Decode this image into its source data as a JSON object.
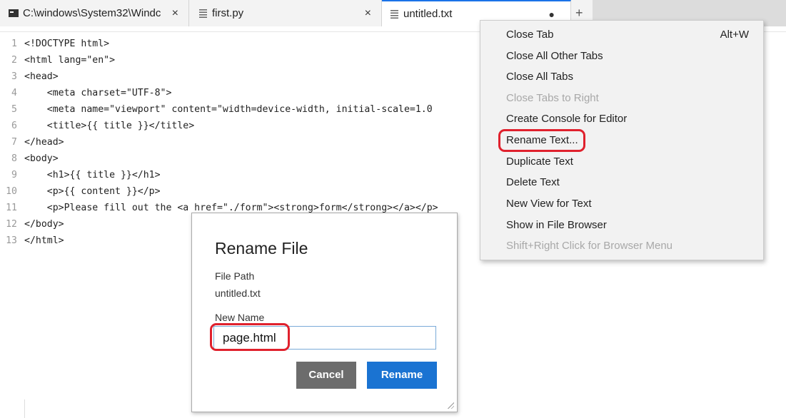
{
  "tabs": [
    {
      "label": "C:\\windows\\System32\\Windc",
      "icon": "terminal-icon",
      "close": "×"
    },
    {
      "label": "first.py",
      "icon": "document-icon",
      "close": "×"
    },
    {
      "label": "untitled.txt",
      "icon": "document-icon",
      "modified": "●",
      "active": true
    }
  ],
  "new_tab": "+",
  "editor": {
    "lines": [
      {
        "n": "1",
        "code": "<!DOCTYPE html>"
      },
      {
        "n": "2",
        "code": "<html lang=\"en\">"
      },
      {
        "n": "3",
        "code": "<head>"
      },
      {
        "n": "4",
        "code": "    <meta charset=\"UTF-8\">"
      },
      {
        "n": "5",
        "code": "    <meta name=\"viewport\" content=\"width=device-width, initial-scale=1.0"
      },
      {
        "n": "6",
        "code": "    <title>{{ title }}</title>"
      },
      {
        "n": "7",
        "code": "</head>"
      },
      {
        "n": "8",
        "code": "<body>"
      },
      {
        "n": "9",
        "code": "    <h1>{{ title }}</h1>"
      },
      {
        "n": "10",
        "code": "    <p>{{ content }}</p>"
      },
      {
        "n": "11",
        "code": "    <p>Please fill out the <a href=\"./form\"><strong>form</strong></a></p>"
      },
      {
        "n": "12",
        "code": "</body>"
      },
      {
        "n": "13",
        "code": "</html>"
      }
    ]
  },
  "context_menu": {
    "items": [
      {
        "label": "Close Tab",
        "shortcut": "Alt+W",
        "enabled": true
      },
      {
        "label": "Close All Other Tabs",
        "enabled": true
      },
      {
        "label": "Close All Tabs",
        "enabled": true
      },
      {
        "label": "Close Tabs to Right",
        "enabled": false
      },
      {
        "label": "Create Console for Editor",
        "enabled": true
      },
      {
        "label": "Rename Text...",
        "enabled": true,
        "highlighted": true
      },
      {
        "label": "Duplicate Text",
        "enabled": true
      },
      {
        "label": "Delete Text",
        "enabled": true
      },
      {
        "label": "New View for Text",
        "enabled": true
      },
      {
        "label": "Show in File Browser",
        "enabled": true
      },
      {
        "label": "Shift+Right Click for Browser Menu",
        "enabled": false
      }
    ]
  },
  "dialog": {
    "title": "Rename File",
    "file_path_label": "File Path",
    "file_path_value": "untitled.txt",
    "new_name_label": "New Name",
    "new_name_value": "page.html",
    "cancel_label": "Cancel",
    "rename_label": "Rename"
  },
  "colors": {
    "accent": "#1a73d2",
    "highlight": "#e0212d",
    "cancel": "#6c6c6c"
  }
}
